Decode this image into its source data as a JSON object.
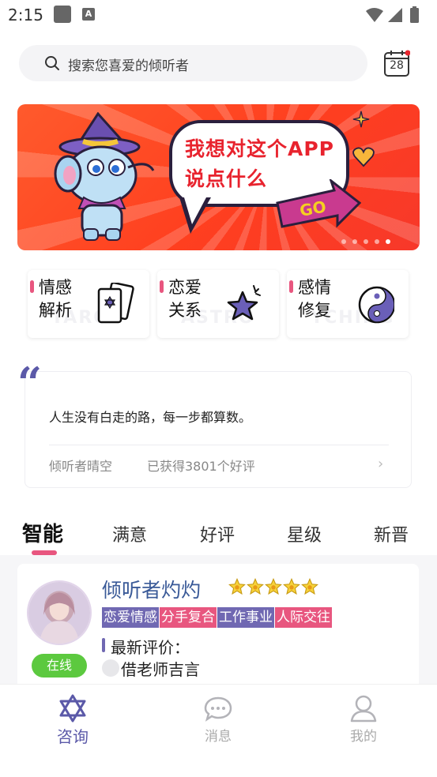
{
  "status_bar": {
    "time": "2:15"
  },
  "search": {
    "placeholder": "搜索您喜爱的倾听者"
  },
  "calendar": {
    "day": "28"
  },
  "banner": {
    "text_line1": "我想对这个APP",
    "text_line2": "说点什么",
    "go_label": "GO",
    "slide_count": 5,
    "active_slide": 5
  },
  "categories": [
    {
      "line1": "情感",
      "line2": "解析",
      "bg_text": "TAROT",
      "icon": "tarot-cards-icon"
    },
    {
      "line1": "恋爱",
      "line2": "关系",
      "bg_text": "ASTRO",
      "icon": "star-wand-icon"
    },
    {
      "line1": "感情",
      "line2": "修复",
      "bg_text": "YCHING",
      "icon": "yin-yang-icon"
    }
  ],
  "quote": {
    "mark": "“",
    "text": "人生没有白走的路，每一步都算数。",
    "author": "倾听者晴空",
    "reviews": "已获得3801个好评",
    "chevron": "›"
  },
  "tabs": [
    {
      "label": "智能",
      "active": true
    },
    {
      "label": "满意",
      "active": false
    },
    {
      "label": "好评",
      "active": false
    },
    {
      "label": "星级",
      "active": false
    },
    {
      "label": "新晋",
      "active": false
    }
  ],
  "listener": {
    "name": "倾听者灼灼",
    "rating": 5,
    "status": "在线",
    "tags": [
      {
        "label": "恋爱情感",
        "color": "#7068b2"
      },
      {
        "label": "分手复合",
        "color": "#e8567f"
      },
      {
        "label": "工作事业",
        "color": "#7068b2"
      },
      {
        "label": "人际交往",
        "color": "#e8567f"
      }
    ],
    "review_label": "最新评价：",
    "reviewer": "借老师吉言"
  },
  "bottom_nav": [
    {
      "label": "咨询",
      "icon": "hexagram-icon",
      "active": true
    },
    {
      "label": "消息",
      "icon": "chat-bubble-icon",
      "active": false
    },
    {
      "label": "我的",
      "icon": "user-icon",
      "active": false
    }
  ],
  "colors": {
    "accent_purple": "#5b59a8",
    "accent_pink": "#e8567f",
    "online_green": "#5cc93f",
    "banner_red": "#ff4a25"
  }
}
